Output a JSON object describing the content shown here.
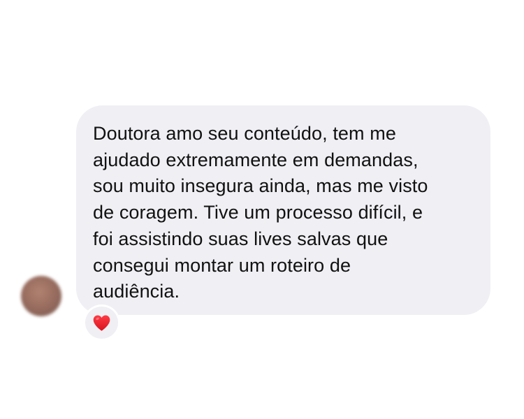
{
  "message": {
    "lines": [
      "Doutora amo seu conteúdo, tem me",
      "ajudado extremamente em demandas,",
      "sou muito insegura ainda, mas me visto",
      "de coragem. Tive um processo difícil, e",
      "foi assistindo suas lives salvas que",
      "consegui montar um roteiro de",
      "audiência."
    ]
  },
  "reaction": {
    "icon": "red-heart-icon",
    "color": "#e8202e"
  },
  "bubble_color": "#efeff4"
}
